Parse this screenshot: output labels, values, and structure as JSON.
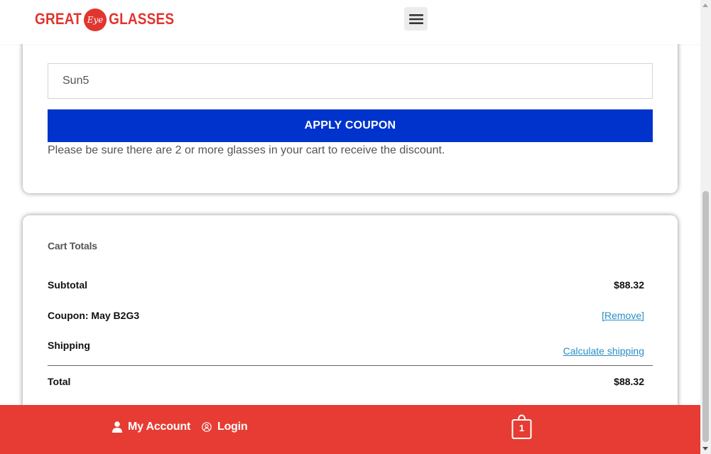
{
  "header": {
    "logo_left": "GREAT",
    "logo_middle": "Eye",
    "logo_right": "GLASSES"
  },
  "coupon": {
    "input_value": "Sun5",
    "apply_label": "APPLY COUPON",
    "note": "Please be sure there are 2 or more glasses in your cart to receive the discount."
  },
  "totals": {
    "title": "Cart Totals",
    "subtotal_label": "Subtotal",
    "subtotal_value": "$88.32",
    "coupon_label": "Coupon: May B2G3",
    "coupon_remove": "[Remove]",
    "shipping_label": "Shipping",
    "shipping_link": "Calculate shipping",
    "total_label": "Total",
    "total_value": "$88.32"
  },
  "bottom_bar": {
    "account_label": "My Account",
    "login_label": "Login",
    "cart_count": "1"
  },
  "colors": {
    "brand_red": "#e1352f",
    "bottom_bar": "#e63c33",
    "apply_button": "#0033cc",
    "link": "#2a8fc4"
  }
}
